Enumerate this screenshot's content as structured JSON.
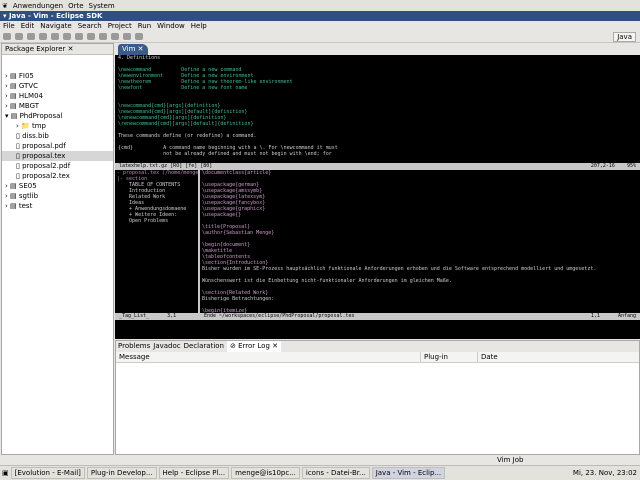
{
  "panel": {
    "items": [
      "Anwendungen",
      "Orte",
      "System"
    ]
  },
  "window": {
    "title": "Java - Vim - Eclipse SDK"
  },
  "menu": [
    "File",
    "Edit",
    "Navigate",
    "Search",
    "Project",
    "Run",
    "Window",
    "Help"
  ],
  "perspective": "Java",
  "package_explorer": {
    "title": "Package Explorer",
    "items": [
      {
        "label": "FI05",
        "level": 0,
        "icon": "project"
      },
      {
        "label": "GTVC",
        "level": 0,
        "icon": "project"
      },
      {
        "label": "HLM04",
        "level": 0,
        "icon": "project"
      },
      {
        "label": "MBGT",
        "level": 0,
        "icon": "project"
      },
      {
        "label": "PhdProposal",
        "level": 0,
        "icon": "project",
        "expanded": true
      },
      {
        "label": "tmp",
        "level": 1,
        "icon": "folder"
      },
      {
        "label": "diss.bib",
        "level": 1,
        "icon": "file"
      },
      {
        "label": "proposal.pdf",
        "level": 1,
        "icon": "file"
      },
      {
        "label": "proposal.tex",
        "level": 1,
        "icon": "tex-file",
        "selected": true
      },
      {
        "label": "proposal2.pdf",
        "level": 1,
        "icon": "file"
      },
      {
        "label": "proposal2.tex",
        "level": 1,
        "icon": "tex-file"
      },
      {
        "label": "SE05",
        "level": 0,
        "icon": "project"
      },
      {
        "label": "sgtlib",
        "level": 0,
        "icon": "project"
      },
      {
        "label": "test",
        "level": 0,
        "icon": "project"
      }
    ]
  },
  "editor": {
    "tab": "Vim",
    "help_lines": [
      "4. Definitions",
      "",
      "\\newcommand          Define a new command",
      "\\newenvironment      Define a new environment",
      "\\newtheorem          Define a new theorem-like environment",
      "\\newfont             Define a new font name",
      "",
      "",
      "\\newcommand{cmd}[args]{definition}",
      "\\newcommand{cmd}[args][default]{definition}",
      "\\renewcommand{cmd}[args]{definition}",
      "\\renewcommand{cmd}[args][default]{definition}",
      "",
      "These commands define (or redefine) a command.",
      "",
      "{cmd}          A command name beginning with a \\. For \\newcommand it must",
      "               not be already defined and must not begin with \\end; for"
    ],
    "help_status": "latexhelp.txt.gz [RO] [fe] [80]",
    "help_pos": "207,2-16",
    "help_pct": "95%",
    "taglist": [
      "- proposal.tex (/home/menge/w",
      "|- section",
      "    TABLE OF CONTENTS",
      "    Introduction",
      "    Related Work",
      "    Ideas",
      "    + Anwendungsdomaene",
      "    + Weitere Ideen:",
      "    Open Problems"
    ],
    "source_lines": [
      "\\documentclass{article}",
      "",
      "\\usepackage{german}",
      "\\usepackage{amssymb}",
      "\\usepackage{latexsym}",
      "\\usepackage{fancybox}",
      "\\usepackage{graphicx}",
      "\\usepackage{}",
      "",
      "\\title{Proposal}",
      "\\author{Sebastian Menge}",
      "",
      "\\begin{document}",
      "\\maketitle",
      "\\tableofcontents",
      "\\section{Introduction}",
      "Bisher wurden im SE-Prozess hauptsächlich funktionale Anforderungen erhoben und die Software entsprechend modelliert und umgesetzt.",
      "",
      "Wünschenswert ist die Einbettung nicht-funktionaler Anforderungen im gleichen Maße.",
      "",
      "\\section{Related Work}",
      "Bisherige Betrachtungen:",
      "",
      "\\begin{itemize}"
    ],
    "tag_status": "_Tag_List_      3,1",
    "source_status": "Ende ~/workspaces/eclipse/PhdProposal/proposal.tex",
    "source_pos": "1,1",
    "source_pct": "Anfang"
  },
  "bottom_panel": {
    "tabs": [
      "Problems",
      "Javadoc",
      "Declaration",
      "Error Log"
    ],
    "active_tab": "Error Log",
    "columns": [
      "Message",
      "Plug-in",
      "Date"
    ]
  },
  "statusbar": {
    "job": "Vim Job"
  },
  "taskbar": {
    "tasks": [
      "[Evolution - E-Mail]",
      "Plug-in Develop...",
      "Help - Eclipse Pl...",
      "menge@is10pc...",
      "icons - Datei-Br...",
      "Java - Vim - Eclip..."
    ],
    "active": "Java - Vim - Eclip...",
    "clock": "Mi, 23. Nov, 23:02"
  }
}
